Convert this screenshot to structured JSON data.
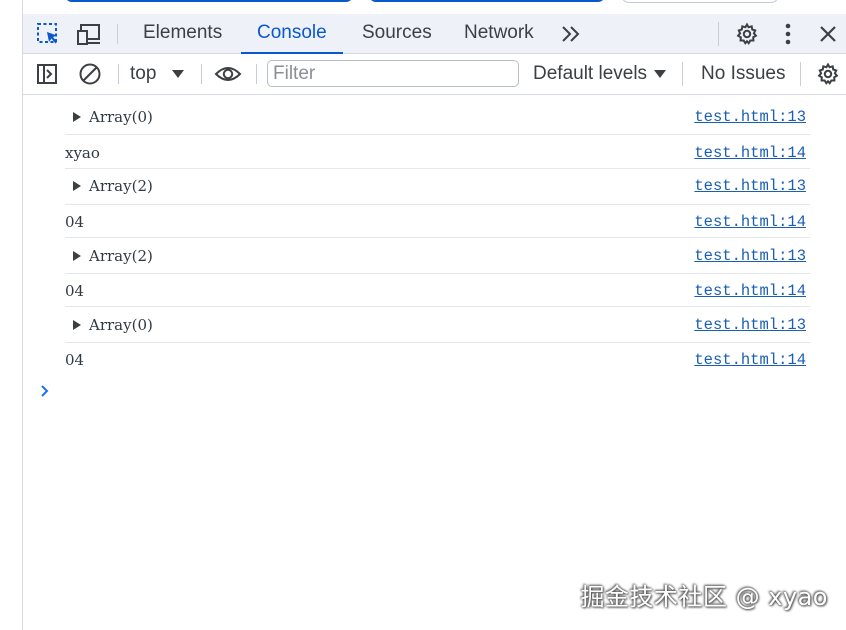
{
  "tabs": {
    "items": [
      {
        "label": "Elements",
        "active": false
      },
      {
        "label": "Console",
        "active": true
      },
      {
        "label": "Sources",
        "active": false
      },
      {
        "label": "Network",
        "active": false
      }
    ]
  },
  "toolbar": {
    "context": "top",
    "filter_placeholder": "Filter",
    "levels": "Default levels",
    "issues": "No Issues"
  },
  "console": {
    "rows": [
      {
        "message": "Array(0)",
        "expandable": true,
        "source": "test.html:13"
      },
      {
        "message": "xyao",
        "expandable": false,
        "source": "test.html:14"
      },
      {
        "message": "Array(2)",
        "expandable": true,
        "source": "test.html:13"
      },
      {
        "message": "04",
        "expandable": false,
        "source": "test.html:14"
      },
      {
        "message": "Array(2)",
        "expandable": true,
        "source": "test.html:13"
      },
      {
        "message": "04",
        "expandable": false,
        "source": "test.html:14"
      },
      {
        "message": "Array(0)",
        "expandable": true,
        "source": "test.html:13"
      },
      {
        "message": "04",
        "expandable": false,
        "source": "test.html:14"
      }
    ]
  },
  "watermark": "掘金技术社区 @ xyao",
  "colors": {
    "accent": "#0b57d0",
    "link": "#1a5fb4",
    "tabbar_bg": "#eef2f8"
  }
}
